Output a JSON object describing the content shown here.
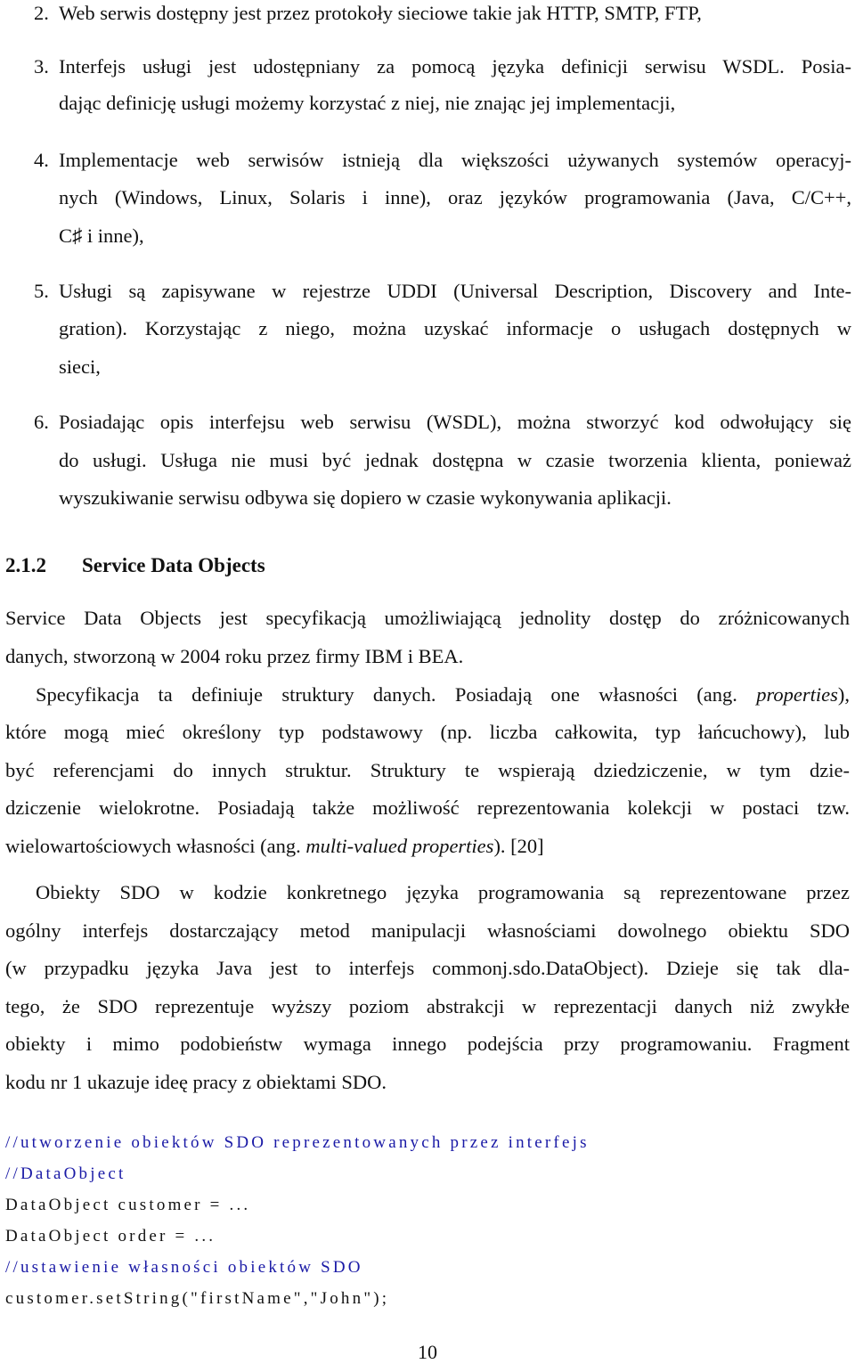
{
  "list_items": [
    {
      "number": "2.",
      "lines": [
        "Web serwis dostępny jest przez protokoły sieciowe takie jak HTTP, SMTP, FTP,"
      ]
    },
    {
      "number": "3.",
      "lines": [
        "Interfejs usługi jest udostępniany za pomocą języka definicji serwisu WSDL. Posia-",
        "dając definicję usługi możemy korzystać z niej, nie znając jej implementacji,"
      ]
    },
    {
      "number": "4.",
      "lines": [
        "Implementacje web serwisów istnieją dla większości używanych systemów operacyj-",
        "nych (Windows, Linux, Solaris i inne), oraz języków programowania (Java, C/C++,",
        "C♯ i inne),"
      ]
    },
    {
      "number": "5.",
      "lines": [
        "Usługi są zapisywane w rejestrze UDDI (Universal Description, Discovery and Inte-",
        "gration). Korzystając z niego, można uzyskać informacje o usługach dostępnych w",
        "sieci,"
      ]
    },
    {
      "number": "6.",
      "lines": [
        "Posiadając opis interfejsu web serwisu (WSDL), można stworzyć kod odwołujący się",
        "do usługi. Usługa nie musi być jednak dostępna w czasie tworzenia klienta, ponieważ",
        "wyszukiwanie serwisu odbywa się dopiero w czasie wykonywania aplikacji."
      ]
    }
  ],
  "section": {
    "number": "2.1.2",
    "title": "Service Data Objects"
  },
  "paragraphs": {
    "p1": [
      "Service Data Objects jest specyfikacją umożliwiającą jednolity dostęp do zróżnicowanych",
      "danych, stworzoną w 2004 roku przez firmy IBM i BEA."
    ],
    "p2": {
      "l1_a": "Specyfikacja ta definiuje struktury danych. Posiadają one własności (ang. ",
      "l1_em": "properties",
      "l1_b": "),",
      "l2": "które mogą mieć określony typ podstawowy (np. liczba całkowita, typ łańcuchowy), lub",
      "l3": "być referencjami do innych struktur. Struktury te wspierają dziedziczenie, w tym dzie-",
      "l4": "dziczenie wielokrotne. Posiadają także możliwość reprezentowania kolekcji w postaci tzw.",
      "l5_a": "wielowartościowych własności (ang. ",
      "l5_em": "multi-valued properties",
      "l5_b": "). [20]"
    },
    "p3": [
      "Obiekty SDO w kodzie konkretnego języka programowania są reprezentowane przez",
      "ogólny interfejs dostarczający metod manipulacji własnościami dowolnego obiektu SDO",
      "(w przypadku języka Java jest to interfejs commonj.sdo.DataObject). Dzieje się tak dla-",
      "tego, że SDO reprezentuje wyższy poziom abstrakcji w reprezentacji danych niż zwykłe",
      "obiekty i mimo podobieństw wymaga innego podejścia przy programowaniu. Fragment",
      "kodu nr 1 ukazuje ideę pracy z obiektami SDO."
    ]
  },
  "code_listing": [
    {
      "text": "//utworzenie obiektów SDO reprezentowanych przez interfejs",
      "kind": "comment"
    },
    {
      "text": "//DataObject",
      "kind": "comment"
    },
    {
      "text": "DataObject customer = ...",
      "kind": "code"
    },
    {
      "text": "DataObject order = ...",
      "kind": "code"
    },
    {
      "text": "//ustawienie własności obiektów SDO",
      "kind": "comment"
    },
    {
      "text": "customer.setString(\"firstName\",\"John\");",
      "kind": "code"
    }
  ],
  "colors": {
    "comment": "#1a1aa6",
    "text": "#111111"
  },
  "page_number": "10"
}
